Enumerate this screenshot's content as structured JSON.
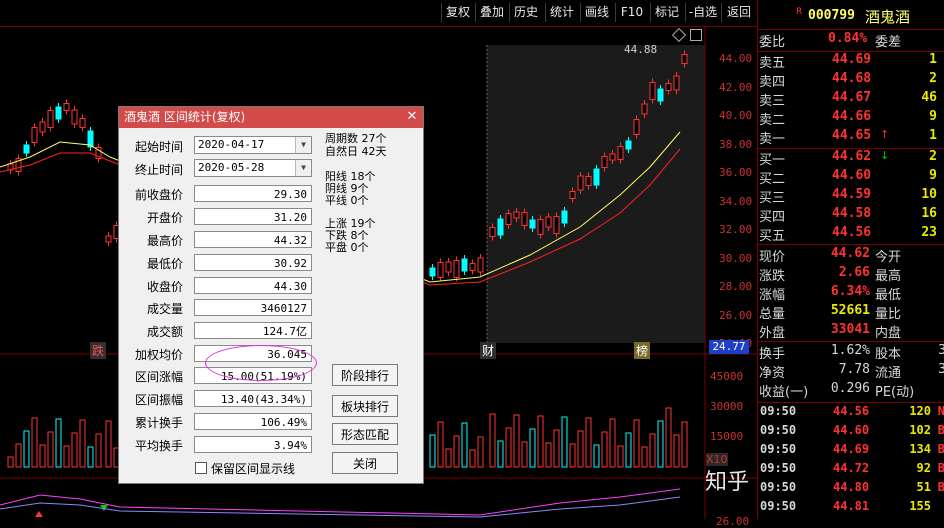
{
  "toolbar": {
    "items": [
      "复权",
      "叠加",
      "历史",
      "统计",
      "画线",
      "F10",
      "标记",
      "-自选",
      "返回"
    ]
  },
  "chart": {
    "price_axis": [
      "44.00",
      "42.00",
      "40.00",
      "38.00",
      "36.00",
      "34.00",
      "32.00",
      "30.00",
      "28.00",
      "26.00",
      "24.00"
    ],
    "volume_axis": [
      "45000",
      "30000",
      "15000",
      "X10"
    ],
    "bottom_axis": "26.00",
    "high_marker": "44.88",
    "current_price_tag": "24.77",
    "markers": [
      "跌",
      "财",
      "榜"
    ],
    "colors": {
      "up": "#ff3232",
      "down": "#00ffff",
      "ma1": "#ffff66",
      "ma2": "#ff2020",
      "highlight": "#1e1e1e"
    }
  },
  "dialog": {
    "title": "酒鬼酒 区间统计(复权)",
    "start_label": "起始时间",
    "start_value": "2020-04-17",
    "end_label": "终止时间",
    "end_value": "2020-05-28",
    "fields": [
      {
        "label": "前收盘价",
        "value": "29.30"
      },
      {
        "label": "开盘价",
        "value": "31.20"
      },
      {
        "label": "最高价",
        "value": "44.32"
      },
      {
        "label": "最低价",
        "value": "30.92"
      },
      {
        "label": "收盘价",
        "value": "44.30"
      },
      {
        "label": "成交量",
        "value": "3460127"
      },
      {
        "label": "成交额",
        "value": "124.7亿"
      },
      {
        "label": "加权均价",
        "value": "36.045"
      },
      {
        "label": "区间涨幅",
        "value": "15.00(51.19%)"
      },
      {
        "label": "区间振幅",
        "value": "13.40(43.34%)"
      },
      {
        "label": "累计换手",
        "value": "106.49%"
      },
      {
        "label": "平均换手",
        "value": "3.94%"
      }
    ],
    "stats": {
      "period_days": "周期数 27个",
      "natural_days": "自然日 42天",
      "yang": "阳线 18个",
      "yin": "阴线 9个",
      "flat_line": "平线 0个",
      "rise": "上涨 19个",
      "fall": "下跌 8个",
      "flat": "平盘 0个"
    },
    "buttons": {
      "stage_rank": "阶段排行",
      "sector_rank": "板块排行",
      "pattern_match": "形态匹配",
      "close": "关闭"
    },
    "checkbox_label": "保留区间显示线"
  },
  "quote": {
    "badge": "R",
    "code": "000799",
    "name": "酒鬼酒",
    "weibi_label": "委比",
    "weibi_value": "0.84%",
    "weicha_label": "委差",
    "sells": [
      {
        "label": "卖五",
        "price": "44.69",
        "vol": "1"
      },
      {
        "label": "卖四",
        "price": "44.68",
        "vol": "2"
      },
      {
        "label": "卖三",
        "price": "44.67",
        "vol": "46"
      },
      {
        "label": "卖二",
        "price": "44.66",
        "vol": "9"
      },
      {
        "label": "卖一",
        "price": "44.65",
        "vol": "1"
      }
    ],
    "buys": [
      {
        "label": "买一",
        "price": "44.62",
        "vol": "2"
      },
      {
        "label": "买二",
        "price": "44.60",
        "vol": "9"
      },
      {
        "label": "买三",
        "price": "44.59",
        "vol": "10"
      },
      {
        "label": "买四",
        "price": "44.58",
        "vol": "16"
      },
      {
        "label": "买五",
        "price": "44.56",
        "vol": "23"
      }
    ],
    "stats": [
      {
        "l1": "现价",
        "v1": "44.62",
        "l2": "今开"
      },
      {
        "l1": "涨跌",
        "v1": "2.66",
        "l2": "最高"
      },
      {
        "l1": "涨幅",
        "v1": "6.34%",
        "l2": "最低"
      },
      {
        "l1": "总量",
        "v1": "52661",
        "l2": "量比"
      },
      {
        "l1": "外盘",
        "v1": "33041",
        "l2": "内盘"
      }
    ],
    "stats2": [
      {
        "l1": "换手",
        "v1": "1.62%",
        "l2": "股本",
        "tail": "3"
      },
      {
        "l1": "净资",
        "v1": "7.78",
        "l2": "流通",
        "tail": "3"
      },
      {
        "l1": "收益(一)",
        "v1": "0.296",
        "l2": "PE(动)",
        "tail": ""
      }
    ],
    "ticks": [
      {
        "time": "09:50",
        "price": "44.56",
        "vol": "120",
        "tail": "N"
      },
      {
        "time": "09:50",
        "price": "44.60",
        "vol": "102",
        "tail": "B"
      },
      {
        "time": "09:50",
        "price": "44.69",
        "vol": "134",
        "tail": "B"
      },
      {
        "time": "09:50",
        "price": "44.72",
        "vol": "92",
        "tail": "B"
      },
      {
        "time": "09:50",
        "price": "44.80",
        "vol": "51",
        "tail": "B"
      },
      {
        "time": "09:50",
        "price": "44.81",
        "vol": "155",
        "tail": ""
      }
    ]
  },
  "watermark": "知乎 @股市雄风"
}
